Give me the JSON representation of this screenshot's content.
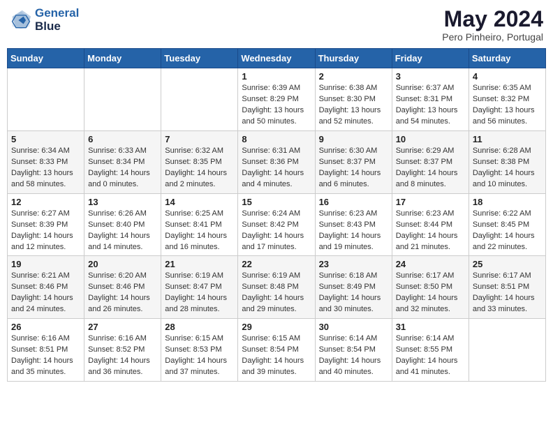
{
  "header": {
    "logo_line1": "General",
    "logo_line2": "Blue",
    "month_title": "May 2024",
    "location": "Pero Pinheiro, Portugal"
  },
  "weekdays": [
    "Sunday",
    "Monday",
    "Tuesday",
    "Wednesday",
    "Thursday",
    "Friday",
    "Saturday"
  ],
  "weeks": [
    [
      {
        "day": "",
        "sunrise": "",
        "sunset": "",
        "daylight": ""
      },
      {
        "day": "",
        "sunrise": "",
        "sunset": "",
        "daylight": ""
      },
      {
        "day": "",
        "sunrise": "",
        "sunset": "",
        "daylight": ""
      },
      {
        "day": "1",
        "sunrise": "Sunrise: 6:39 AM",
        "sunset": "Sunset: 8:29 PM",
        "daylight": "Daylight: 13 hours and 50 minutes."
      },
      {
        "day": "2",
        "sunrise": "Sunrise: 6:38 AM",
        "sunset": "Sunset: 8:30 PM",
        "daylight": "Daylight: 13 hours and 52 minutes."
      },
      {
        "day": "3",
        "sunrise": "Sunrise: 6:37 AM",
        "sunset": "Sunset: 8:31 PM",
        "daylight": "Daylight: 13 hours and 54 minutes."
      },
      {
        "day": "4",
        "sunrise": "Sunrise: 6:35 AM",
        "sunset": "Sunset: 8:32 PM",
        "daylight": "Daylight: 13 hours and 56 minutes."
      }
    ],
    [
      {
        "day": "5",
        "sunrise": "Sunrise: 6:34 AM",
        "sunset": "Sunset: 8:33 PM",
        "daylight": "Daylight: 13 hours and 58 minutes."
      },
      {
        "day": "6",
        "sunrise": "Sunrise: 6:33 AM",
        "sunset": "Sunset: 8:34 PM",
        "daylight": "Daylight: 14 hours and 0 minutes."
      },
      {
        "day": "7",
        "sunrise": "Sunrise: 6:32 AM",
        "sunset": "Sunset: 8:35 PM",
        "daylight": "Daylight: 14 hours and 2 minutes."
      },
      {
        "day": "8",
        "sunrise": "Sunrise: 6:31 AM",
        "sunset": "Sunset: 8:36 PM",
        "daylight": "Daylight: 14 hours and 4 minutes."
      },
      {
        "day": "9",
        "sunrise": "Sunrise: 6:30 AM",
        "sunset": "Sunset: 8:37 PM",
        "daylight": "Daylight: 14 hours and 6 minutes."
      },
      {
        "day": "10",
        "sunrise": "Sunrise: 6:29 AM",
        "sunset": "Sunset: 8:37 PM",
        "daylight": "Daylight: 14 hours and 8 minutes."
      },
      {
        "day": "11",
        "sunrise": "Sunrise: 6:28 AM",
        "sunset": "Sunset: 8:38 PM",
        "daylight": "Daylight: 14 hours and 10 minutes."
      }
    ],
    [
      {
        "day": "12",
        "sunrise": "Sunrise: 6:27 AM",
        "sunset": "Sunset: 8:39 PM",
        "daylight": "Daylight: 14 hours and 12 minutes."
      },
      {
        "day": "13",
        "sunrise": "Sunrise: 6:26 AM",
        "sunset": "Sunset: 8:40 PM",
        "daylight": "Daylight: 14 hours and 14 minutes."
      },
      {
        "day": "14",
        "sunrise": "Sunrise: 6:25 AM",
        "sunset": "Sunset: 8:41 PM",
        "daylight": "Daylight: 14 hours and 16 minutes."
      },
      {
        "day": "15",
        "sunrise": "Sunrise: 6:24 AM",
        "sunset": "Sunset: 8:42 PM",
        "daylight": "Daylight: 14 hours and 17 minutes."
      },
      {
        "day": "16",
        "sunrise": "Sunrise: 6:23 AM",
        "sunset": "Sunset: 8:43 PM",
        "daylight": "Daylight: 14 hours and 19 minutes."
      },
      {
        "day": "17",
        "sunrise": "Sunrise: 6:23 AM",
        "sunset": "Sunset: 8:44 PM",
        "daylight": "Daylight: 14 hours and 21 minutes."
      },
      {
        "day": "18",
        "sunrise": "Sunrise: 6:22 AM",
        "sunset": "Sunset: 8:45 PM",
        "daylight": "Daylight: 14 hours and 22 minutes."
      }
    ],
    [
      {
        "day": "19",
        "sunrise": "Sunrise: 6:21 AM",
        "sunset": "Sunset: 8:46 PM",
        "daylight": "Daylight: 14 hours and 24 minutes."
      },
      {
        "day": "20",
        "sunrise": "Sunrise: 6:20 AM",
        "sunset": "Sunset: 8:46 PM",
        "daylight": "Daylight: 14 hours and 26 minutes."
      },
      {
        "day": "21",
        "sunrise": "Sunrise: 6:19 AM",
        "sunset": "Sunset: 8:47 PM",
        "daylight": "Daylight: 14 hours and 28 minutes."
      },
      {
        "day": "22",
        "sunrise": "Sunrise: 6:19 AM",
        "sunset": "Sunset: 8:48 PM",
        "daylight": "Daylight: 14 hours and 29 minutes."
      },
      {
        "day": "23",
        "sunrise": "Sunrise: 6:18 AM",
        "sunset": "Sunset: 8:49 PM",
        "daylight": "Daylight: 14 hours and 30 minutes."
      },
      {
        "day": "24",
        "sunrise": "Sunrise: 6:17 AM",
        "sunset": "Sunset: 8:50 PM",
        "daylight": "Daylight: 14 hours and 32 minutes."
      },
      {
        "day": "25",
        "sunrise": "Sunrise: 6:17 AM",
        "sunset": "Sunset: 8:51 PM",
        "daylight": "Daylight: 14 hours and 33 minutes."
      }
    ],
    [
      {
        "day": "26",
        "sunrise": "Sunrise: 6:16 AM",
        "sunset": "Sunset: 8:51 PM",
        "daylight": "Daylight: 14 hours and 35 minutes."
      },
      {
        "day": "27",
        "sunrise": "Sunrise: 6:16 AM",
        "sunset": "Sunset: 8:52 PM",
        "daylight": "Daylight: 14 hours and 36 minutes."
      },
      {
        "day": "28",
        "sunrise": "Sunrise: 6:15 AM",
        "sunset": "Sunset: 8:53 PM",
        "daylight": "Daylight: 14 hours and 37 minutes."
      },
      {
        "day": "29",
        "sunrise": "Sunrise: 6:15 AM",
        "sunset": "Sunset: 8:54 PM",
        "daylight": "Daylight: 14 hours and 39 minutes."
      },
      {
        "day": "30",
        "sunrise": "Sunrise: 6:14 AM",
        "sunset": "Sunset: 8:54 PM",
        "daylight": "Daylight: 14 hours and 40 minutes."
      },
      {
        "day": "31",
        "sunrise": "Sunrise: 6:14 AM",
        "sunset": "Sunset: 8:55 PM",
        "daylight": "Daylight: 14 hours and 41 minutes."
      },
      {
        "day": "",
        "sunrise": "",
        "sunset": "",
        "daylight": ""
      }
    ]
  ]
}
